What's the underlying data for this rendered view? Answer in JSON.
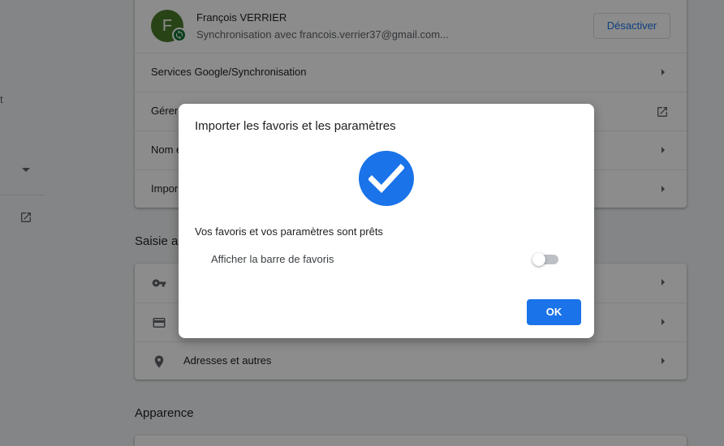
{
  "sidebar": {
    "partial_text": "t"
  },
  "account": {
    "avatar_letter": "F",
    "name": "François VERRIER",
    "sync_status": "Synchronisation avec francois.verrier37@gmail.com...",
    "disable_button": "Désactiver"
  },
  "you_and_google": {
    "rows": [
      {
        "label": "Services Google/Synchronisation",
        "trailing": "arrow"
      },
      {
        "label": "Gérer",
        "trailing": "external-link-icon"
      },
      {
        "label": "Nom e",
        "trailing": "arrow"
      },
      {
        "label": "Impor",
        "trailing": "arrow"
      }
    ]
  },
  "autofill": {
    "title": "Saisie au",
    "rows": [
      {
        "icon": "key-icon",
        "label": ""
      },
      {
        "icon": "credit-card-icon",
        "label": ""
      },
      {
        "icon": "location-pin-icon",
        "label": "Adresses et autres"
      }
    ]
  },
  "appearance": {
    "title": "Apparence"
  },
  "dialog": {
    "title": "Importer les favoris et les paramètres",
    "icon": "check-circle-icon",
    "message": "Vos favoris et vos paramètres sont prêts",
    "toggle_label": "Afficher la barre de favoris",
    "toggle_on": false,
    "ok_button": "OK"
  },
  "colors": {
    "accent": "#1a73e8",
    "scrim": "#000000"
  }
}
